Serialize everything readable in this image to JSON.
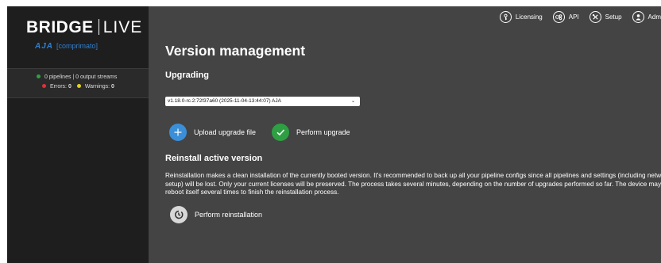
{
  "sidebar": {
    "logo": {
      "bridge": "BRIDGE",
      "live": "LIVE",
      "aja": "AJA",
      "comprimato": "[comprimato]"
    },
    "status": {
      "pipelines_text": "0 pipelines | 0 output streams",
      "errors_label": "Errors:",
      "errors_count": "0",
      "warnings_label": "Warnings:",
      "warnings_count": "0"
    }
  },
  "topnav": {
    "items": [
      {
        "label": "Licensing",
        "icon": "key-icon"
      },
      {
        "label": "API",
        "icon": "gears-icon"
      },
      {
        "label": "Setup",
        "icon": "tools-icon"
      },
      {
        "label": "Adm",
        "icon": "user-icon"
      }
    ]
  },
  "main": {
    "title": "Version management",
    "upgrading": {
      "heading": "Upgrading",
      "selected_version": "v1.18.0-rc.2:72f37a60 (2025-11-04-13:44:07) AJA",
      "upload_label": "Upload upgrade file",
      "perform_label": "Perform upgrade"
    },
    "reinstall": {
      "heading": "Reinstall active version",
      "description": "Reinstallation makes a clean installation of the currently booted version. It's recommended to back up all your pipeline configs since all pipelines and settings (including network setup) will be lost. Only your current licenses will be preserved. The process takes several minutes, depending on the number of upgrades performed so far. The device may reboot itself several times to finish the reinstallation process.",
      "button_label": "Perform reinstallation"
    }
  },
  "colors": {
    "sidebar_bg": "#1e1e1e",
    "main_bg": "#444444",
    "upload_blue": "#3a8fd8",
    "upgrade_green": "#2ea043",
    "error_red": "#e0303a",
    "warning_yellow": "#e3d21a",
    "ok_green": "#2ea043",
    "brand_blue": "#2f7fcf"
  }
}
